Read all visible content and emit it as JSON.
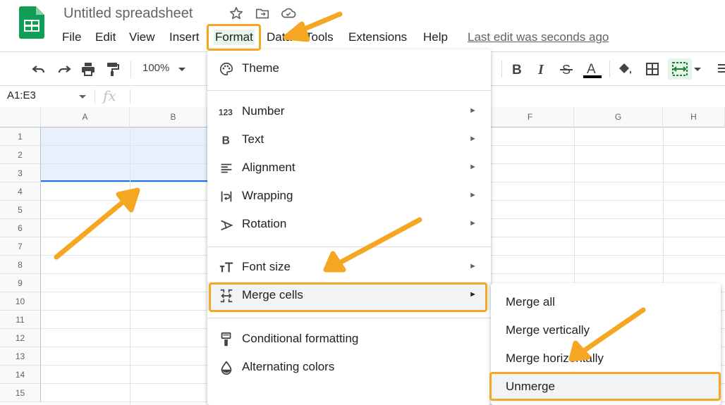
{
  "header": {
    "title": "Untitled spreadsheet",
    "last_edit": "Last edit was seconds ago",
    "menu": [
      "File",
      "Edit",
      "View",
      "Insert",
      "Format",
      "Data",
      "Tools",
      "Extensions",
      "Help"
    ]
  },
  "toolbar": {
    "zoom": "100%"
  },
  "formula_bar": {
    "name_box": "A1:E3",
    "fx": "fx"
  },
  "grid": {
    "columns": [
      "A",
      "B",
      "F",
      "G",
      "H"
    ],
    "rows": [
      "1",
      "2",
      "3",
      "4",
      "5",
      "6",
      "7",
      "8",
      "9",
      "10",
      "11",
      "12",
      "13",
      "14",
      "15"
    ]
  },
  "format_menu": {
    "theme": "Theme",
    "number": "Number",
    "text": "Text",
    "alignment": "Alignment",
    "wrapping": "Wrapping",
    "rotation": "Rotation",
    "font_size": "Font size",
    "merge_cells": "Merge cells",
    "conditional_formatting": "Conditional formatting",
    "alternating_colors": "Alternating colors",
    "submenu_arrow": "►"
  },
  "merge_submenu": {
    "merge_all": "Merge all",
    "merge_vertically": "Merge vertically",
    "merge_horizontally": "Merge horizontally",
    "unmerge": "Unmerge"
  },
  "colors": {
    "accent": "#f5a623",
    "sheets_green": "#0f9d58",
    "selection": "#e8f0fe",
    "selection_border": "#1a73e8"
  }
}
